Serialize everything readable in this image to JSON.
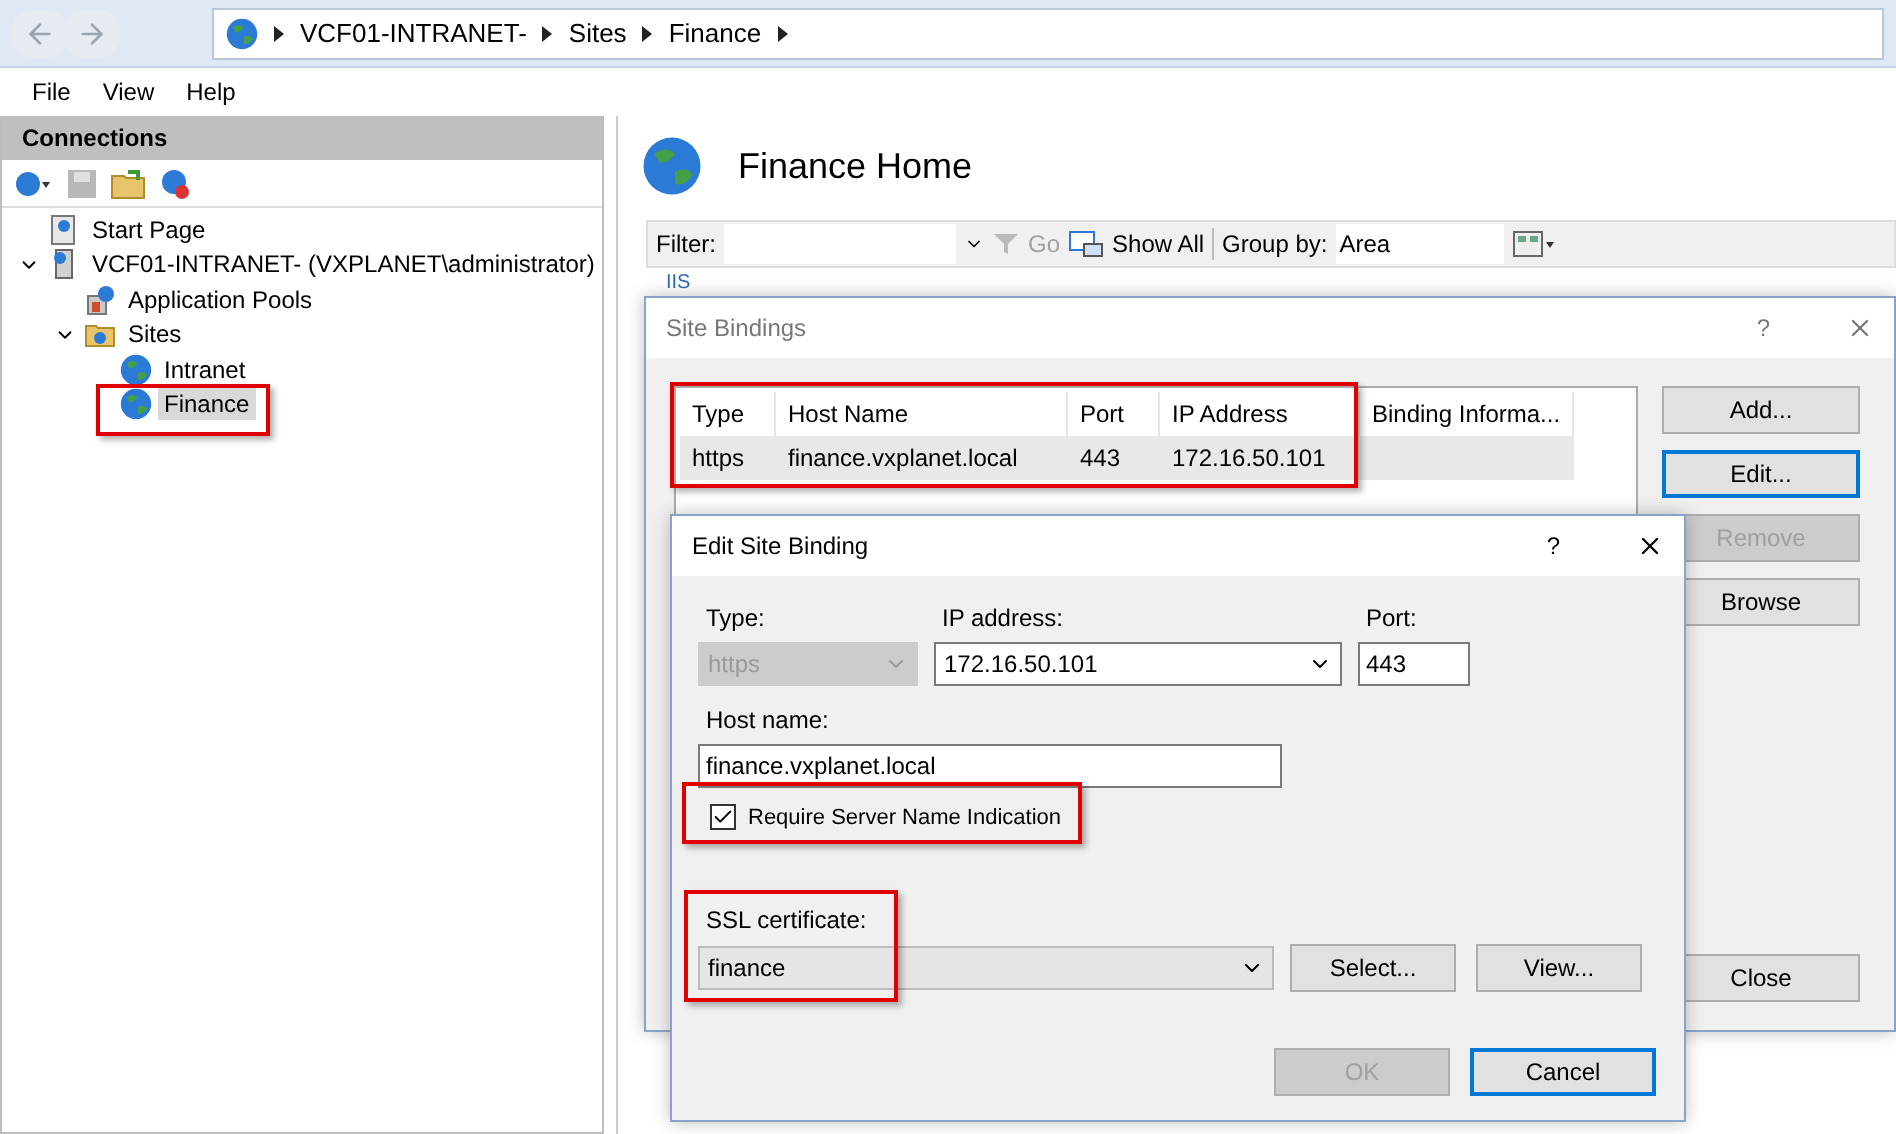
{
  "navigation": {
    "breadcrumb": [
      "VCF01-INTRANET-",
      "Sites",
      "Finance"
    ]
  },
  "menu": [
    "File",
    "View",
    "Help"
  ],
  "connections": {
    "title": "Connections",
    "tree": [
      {
        "label": "Start Page",
        "kind": "page",
        "selected": false
      },
      {
        "label": "VCF01-INTRANET- (VXPLANET\\administrator)",
        "kind": "server",
        "selected": false,
        "expanded": true,
        "children": [
          {
            "label": "Application Pools",
            "kind": "pool",
            "selected": false
          },
          {
            "label": "Sites",
            "kind": "folder",
            "selected": false,
            "expanded": true,
            "children": [
              {
                "label": "Intranet",
                "kind": "site",
                "selected": false
              },
              {
                "label": "Finance",
                "kind": "site",
                "selected": true
              }
            ]
          }
        ]
      }
    ]
  },
  "main": {
    "title": "Finance Home",
    "filter_label": "Filter:",
    "go": "Go",
    "go_disabled": true,
    "show_all": "Show All",
    "group_by_label": "Group by:",
    "group_by_value": "Area",
    "section": "IIS"
  },
  "site_bindings": {
    "title": "Site Bindings",
    "help": "?",
    "columns": [
      "Type",
      "Host Name",
      "Port",
      "IP Address",
      "Binding Informa..."
    ],
    "rows": [
      {
        "cells": [
          "https",
          "finance.vxplanet.local",
          "443",
          "172.16.50.101",
          ""
        ],
        "selected": true
      }
    ],
    "buttons": [
      {
        "label": "Add...",
        "disabled": false,
        "focused": false
      },
      {
        "label": "Edit...",
        "disabled": false,
        "focused": true
      },
      {
        "label": "Remove",
        "disabled": true,
        "focused": false
      },
      {
        "label": "Browse",
        "disabled": false,
        "focused": false
      }
    ],
    "close_button": "Close"
  },
  "edit_binding": {
    "title": "Edit Site Binding",
    "help": "?",
    "type_label": "Type:",
    "type_value": "https",
    "type_disabled": true,
    "ip_label": "IP address:",
    "ip_value": "172.16.50.101",
    "port_label": "Port:",
    "port_value": "443",
    "host_label": "Host name:",
    "host_value": "finance.vxplanet.local",
    "sni_label": "Require Server Name Indication",
    "sni_checked": true,
    "ssl_label": "SSL certificate:",
    "ssl_value": "finance",
    "select_button": "Select...",
    "view_button": "View...",
    "ok": {
      "label": "OK",
      "disabled": true
    },
    "cancel": {
      "label": "Cancel",
      "disabled": false
    }
  }
}
